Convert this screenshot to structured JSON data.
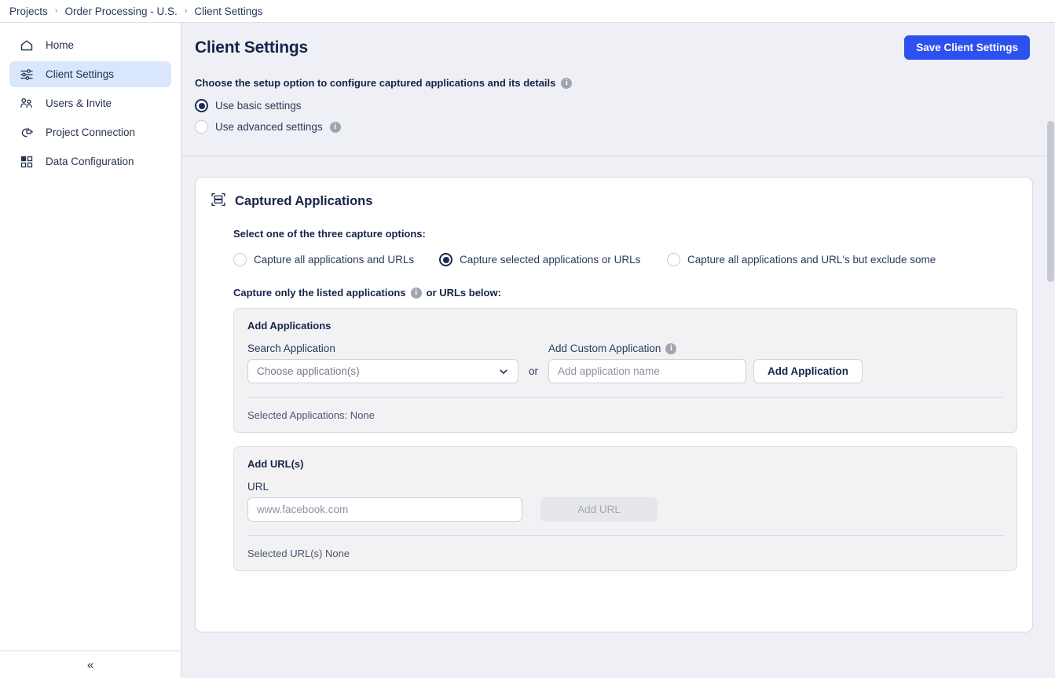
{
  "breadcrumb": {
    "items": [
      "Projects",
      "Order Processing - U.S.",
      "Client Settings"
    ],
    "separator": "›"
  },
  "sidebar": {
    "items": [
      {
        "label": "Home",
        "icon": "home-icon",
        "active": false
      },
      {
        "label": "Client Settings",
        "icon": "sliders-icon",
        "active": true
      },
      {
        "label": "Users & Invite",
        "icon": "users-icon",
        "active": false
      },
      {
        "label": "Project Connection",
        "icon": "plug-icon",
        "active": false
      },
      {
        "label": "Data Configuration",
        "icon": "grid-icon",
        "active": false
      }
    ],
    "collapse_icon": "«"
  },
  "header": {
    "title": "Client Settings",
    "save_label": "Save Client Settings",
    "accent_color": "#2d50f0"
  },
  "setup": {
    "label": "Choose the setup option to configure captured applications and its details",
    "info": "i",
    "options": [
      {
        "label": "Use basic settings",
        "checked": true,
        "info": false
      },
      {
        "label": "Use advanced settings",
        "checked": false,
        "info": true
      }
    ]
  },
  "card": {
    "title": "Captured Applications",
    "icon": "capture-frame-icon",
    "capture_prompt": "Select one of the three capture options:",
    "capture_options": [
      {
        "label": "Capture all applications and URLs",
        "checked": false
      },
      {
        "label": "Capture selected applications or URLs",
        "checked": true
      },
      {
        "label": "Capture all applications and URL's but exclude some",
        "checked": false
      }
    ],
    "listed_label_before": "Capture only the listed applications",
    "listed_label_after": "or URLs below:",
    "applications_panel": {
      "title": "Add Applications",
      "search_label": "Search Application",
      "search_placeholder": "Choose application(s)",
      "or_text": "or",
      "custom_label": "Add Custom Application",
      "custom_placeholder": "Add application name",
      "custom_value": "",
      "add_button": "Add Application",
      "selected_text": "Selected Applications: None"
    },
    "urls_panel": {
      "title": "Add URL(s)",
      "url_label": "URL",
      "url_placeholder": "www.facebook.com",
      "url_value": "",
      "add_button": "Add URL",
      "add_button_disabled": true,
      "selected_text": "Selected URL(s) None"
    }
  }
}
